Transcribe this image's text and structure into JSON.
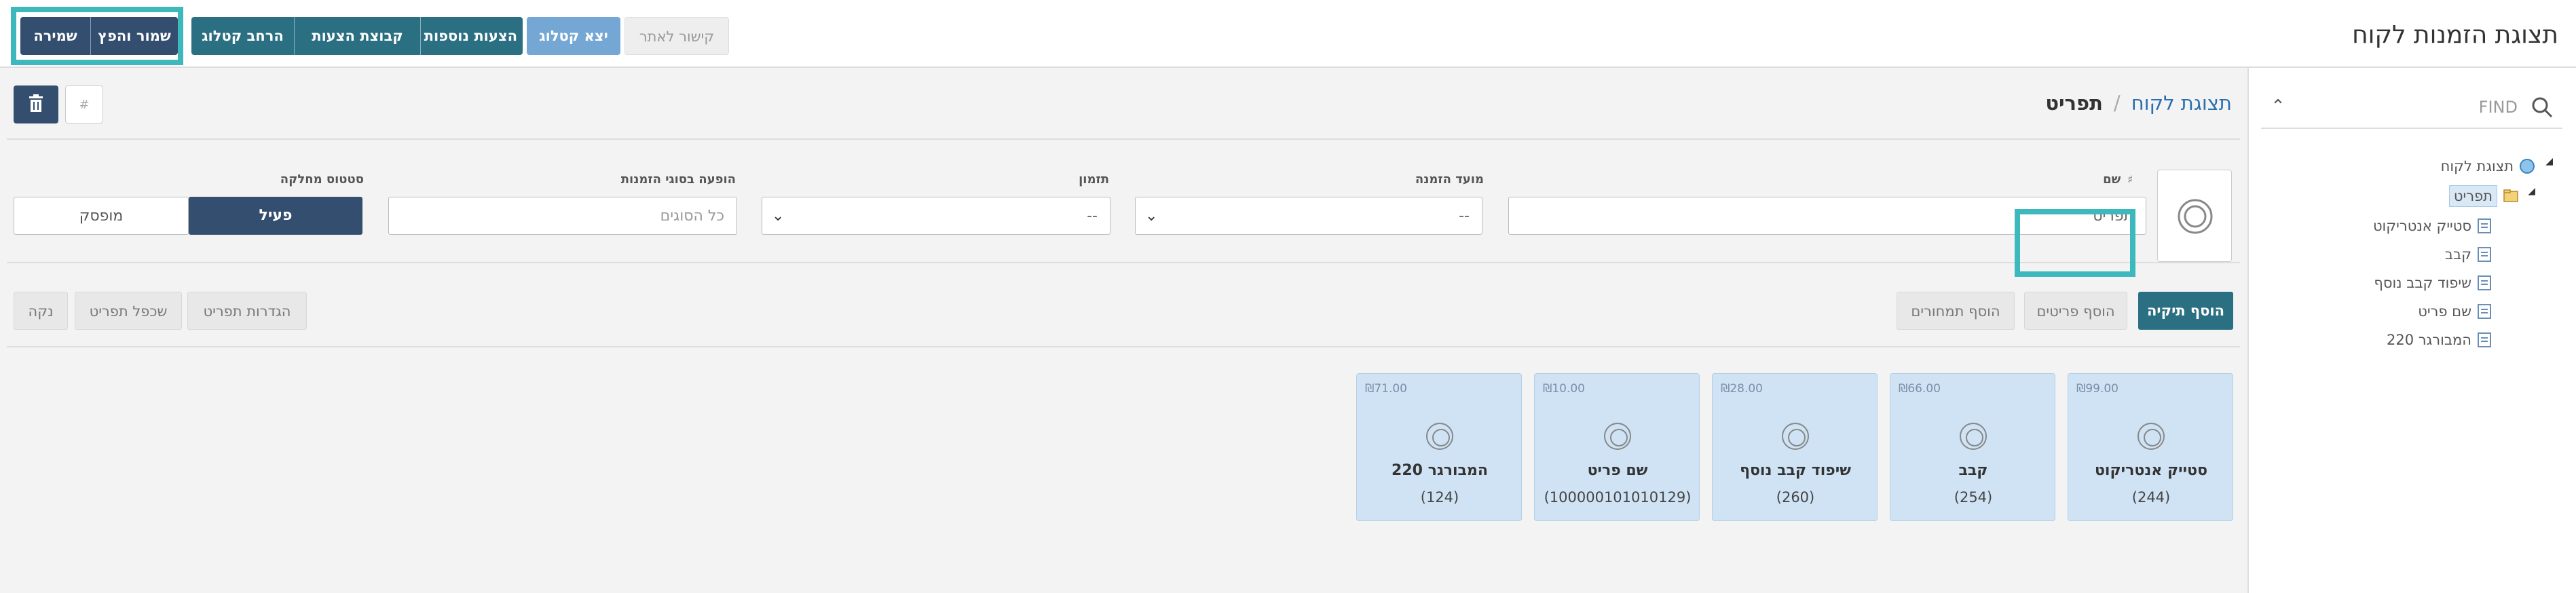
{
  "app": {
    "title": "תצוגת הזמנות לקוח"
  },
  "toolbar": {
    "link_site": "קישור לאתר",
    "export_catalog": "יצא קטלוג",
    "more_offers": "הצעות נוספות",
    "offer_groups": "קבוצת הצעות",
    "expand_catalog": "הרחב קטלוג",
    "save_publish": "שמור והפץ",
    "save": "שמירה"
  },
  "sidebar": {
    "search_placeholder": "FIND",
    "tree": {
      "root": "תצוגת לקוח",
      "selected": "תפריט",
      "items": [
        "סטייק אנטריקוט",
        "קבב",
        "שיפוד קבב נוסף",
        "שם פריט",
        "המבורגר 220"
      ]
    }
  },
  "breadcrumb": {
    "parent": "תצוגת לקוח",
    "separator": "/",
    "current": "תפריט"
  },
  "header_controls": {
    "hash_placeholder": "#"
  },
  "form": {
    "name": {
      "label": "שם",
      "value": "תפריט"
    },
    "order_time": {
      "label": "מועד הזמנה",
      "value": "--"
    },
    "availability": {
      "label": "תזמון",
      "value": "--"
    },
    "order_types": {
      "label": "הופעה בסוגי הזמנות",
      "placeholder": "כל הסוגים"
    },
    "department_status": {
      "label": "סטטוס מחלקה",
      "active": "פעיל",
      "inactive": "מופסק"
    }
  },
  "actions": {
    "add_folder": "הוסף תיקיה",
    "add_items": "הוסף פריטים",
    "add_images": "הוסף תמחורים",
    "menu_settings": "הגדרות תפריט",
    "clone_menu": "שכפל תפריט",
    "clear": "נקה"
  },
  "cards": [
    {
      "name": "סטייק אנטריקוט",
      "code": "(244)",
      "price": "₪99.00"
    },
    {
      "name": "קבב",
      "code": "(254)",
      "price": "₪66.00"
    },
    {
      "name": "שיפוד קבב נוסף",
      "code": "(260)",
      "price": "₪28.00"
    },
    {
      "name": "שם פריט",
      "code": "(100000101010129)",
      "price": "₪10.00"
    },
    {
      "name": "המבורגר 220",
      "code": "(124)",
      "price": "₪71.00"
    }
  ],
  "colors": {
    "accent_teal": "#2b6f82",
    "navy": "#344e6f",
    "light_blue": "#74a7d4",
    "highlight": "#3db8bd",
    "card_bg": "#cfe3f4"
  }
}
